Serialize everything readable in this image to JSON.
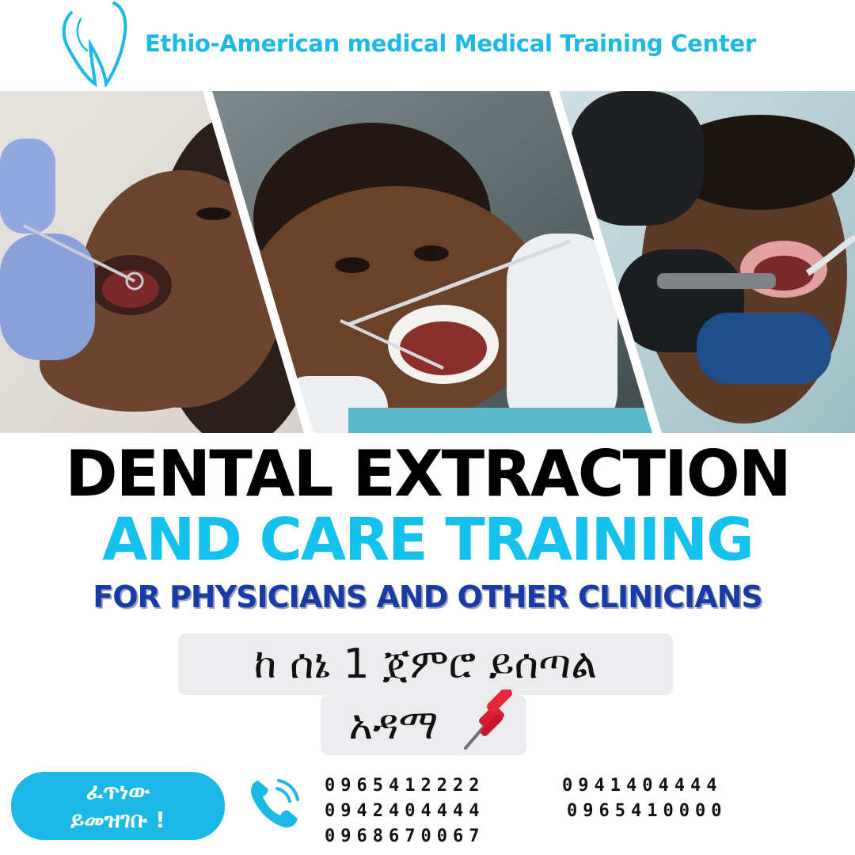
{
  "header": {
    "brand": "Ethio-American medical Medical Training Center",
    "logo_icon": "tooth-logo-icon"
  },
  "headline": {
    "line1": "DENTAL EXTRACTION",
    "line2": "AND CARE TRAINING",
    "line3": "FOR PHYSICIANS AND OTHER CLINICIANS"
  },
  "amharic": {
    "start": "ከ ሰኔ 1 ጀምሮ ይሰጣል",
    "location": "አዳማ",
    "pin_icon": "pushpin-icon"
  },
  "cta": {
    "line1": "ፈጥነው",
    "line2": "ይመዝገቡ !"
  },
  "contact": {
    "icon": "phone-icon",
    "numbers": [
      "0965412222",
      "0941404444",
      "0942404444",
      "0965410000",
      "0968670067"
    ]
  },
  "colors": {
    "accent": "#1cb8e6",
    "navy": "#1a3aa6",
    "panel": "#ececee"
  }
}
